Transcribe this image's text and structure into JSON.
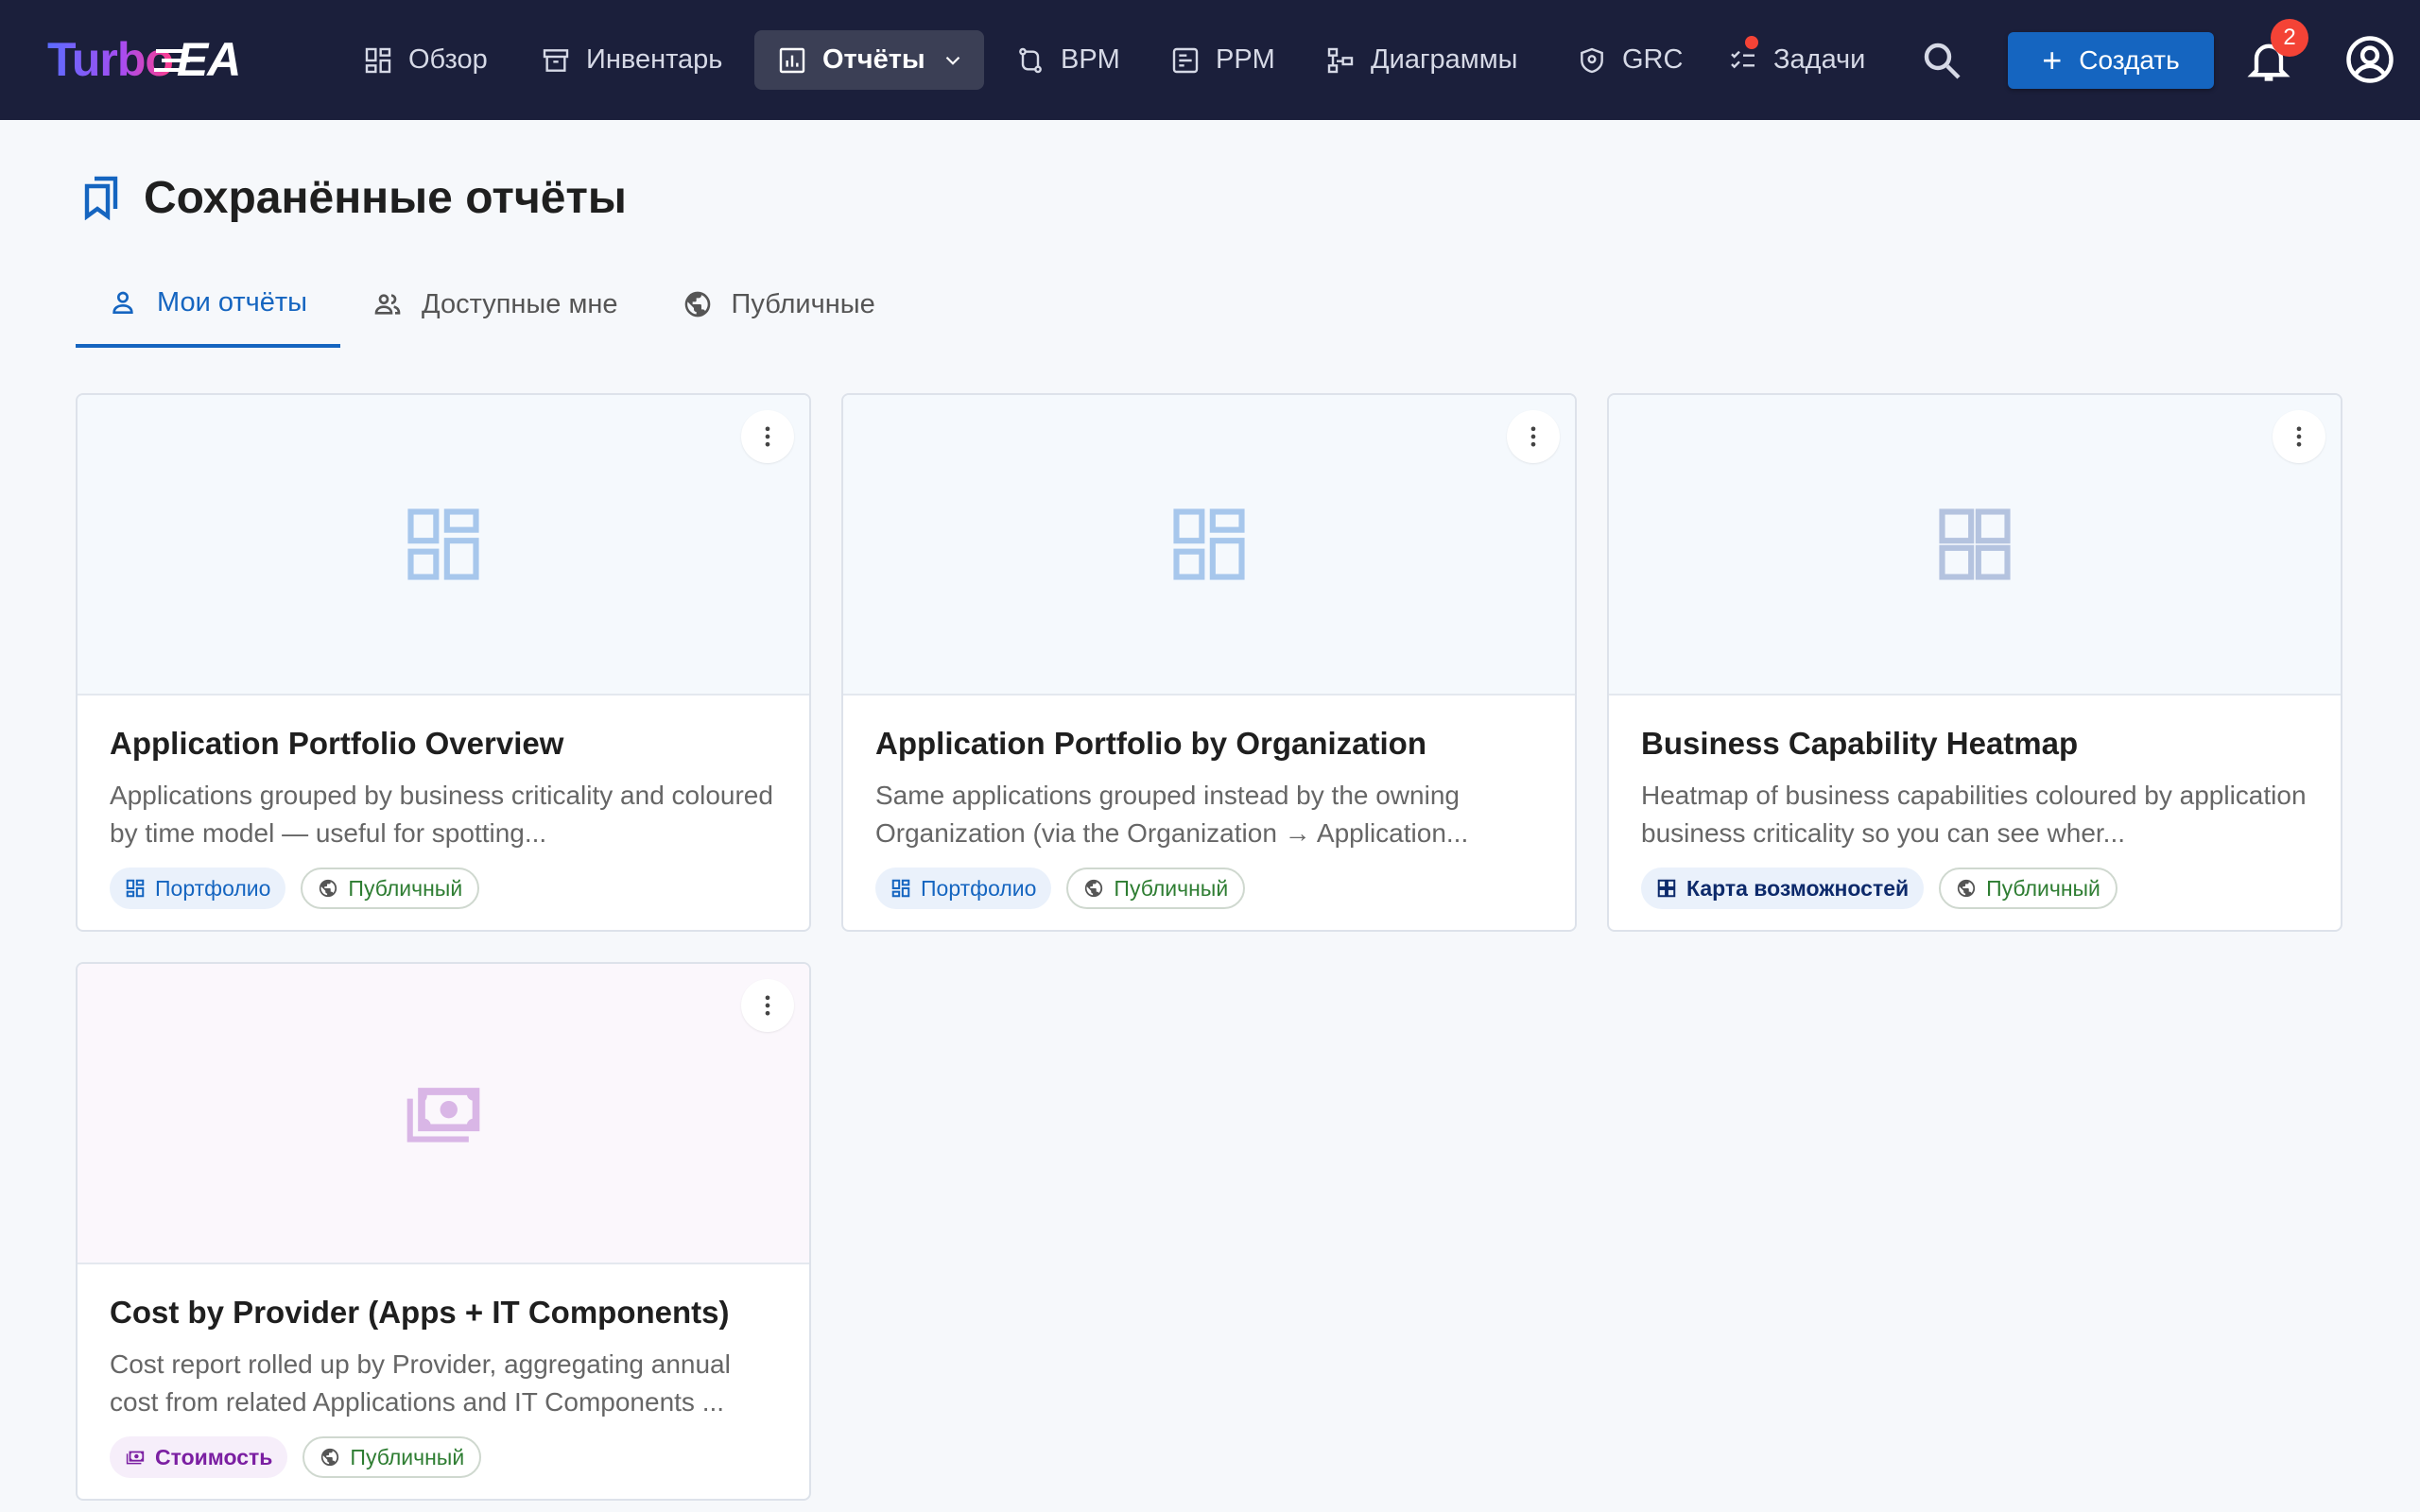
{
  "app": {
    "logo_turbo": "Turbo",
    "logo_ea": "EA"
  },
  "nav": {
    "items": [
      {
        "label": "Обзор",
        "icon": "dashboard-icon"
      },
      {
        "label": "Инвентарь",
        "icon": "inventory-icon"
      },
      {
        "label": "Отчёты",
        "icon": "reports-icon",
        "active": true
      },
      {
        "label": "BPM",
        "icon": "bpm-icon"
      },
      {
        "label": "PPM",
        "icon": "ppm-icon"
      },
      {
        "label": "Диаграммы",
        "icon": "diagrams-icon"
      },
      {
        "label": "GRC",
        "icon": "shield-icon"
      },
      {
        "label": "Задачи",
        "icon": "tasks-icon"
      }
    ],
    "create_label": "Создать",
    "notifications_count": "2"
  },
  "page": {
    "title": "Сохранённые отчёты"
  },
  "tabs": [
    {
      "label": "Мои отчёты",
      "active": true
    },
    {
      "label": "Доступные мне"
    },
    {
      "label": "Публичные"
    }
  ],
  "cards": [
    {
      "title": "Application Portfolio Overview",
      "description": "Applications grouped by business criticality and coloured by time model — useful for spotting...",
      "type_chip": "Портфолио",
      "visibility_chip": "Публичный"
    },
    {
      "title": "Application Portfolio by Organization",
      "description": "Same applications grouped instead by the owning Organization (via the Organization → Application...",
      "type_chip": "Портфолио",
      "visibility_chip": "Публичный"
    },
    {
      "title": "Business Capability Heatmap",
      "description": "Heatmap of business capabilities coloured by application business criticality so you can see wher...",
      "type_chip": "Карта возможностей",
      "visibility_chip": "Публичный"
    },
    {
      "title": "Cost by Provider (Apps + IT Components)",
      "description": "Cost report rolled up by Provider, aggregating annual cost from related Applications and IT Components ...",
      "type_chip": "Стоимость",
      "visibility_chip": "Публичный"
    }
  ],
  "colors": {
    "appbar": "#1b1f3b",
    "accent": "#1565c0",
    "badge": "#f44336",
    "public_green": "#2e7d32",
    "cost_purple": "#7b1fa2"
  }
}
